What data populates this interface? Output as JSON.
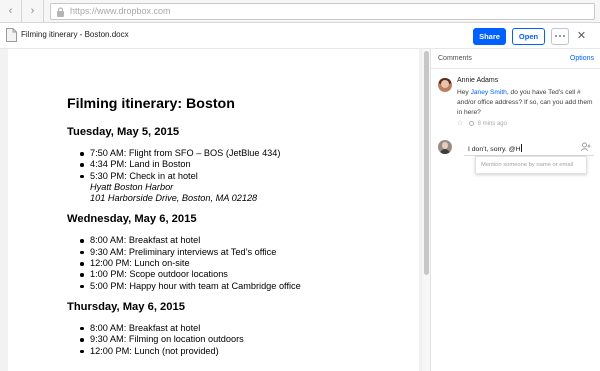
{
  "browser": {
    "url": "https://www.dropbox.com",
    "back_icon": "chevron-left-icon",
    "forward_icon": "chevron-right-icon",
    "lock_icon": "lock-icon"
  },
  "header": {
    "file_name": "Filming itinerary - Boston.docx",
    "share_label": "Share",
    "open_label": "Open",
    "more_icon": "more-icon",
    "close_icon": "close-icon",
    "colors": {
      "accent": "#0061fe"
    }
  },
  "document": {
    "title": "Filming itinerary: Boston",
    "sections": [
      {
        "heading": "Tuesday, May 5, 2015",
        "items": [
          {
            "text": "7:50 AM: Flight from SFO – BOS (JetBlue 434)"
          },
          {
            "text": "4:34 PM: Land in Boston"
          },
          {
            "text": "5:30 PM: Check in at hotel",
            "sub1": "Hyatt Boston Harbor",
            "sub2": "101 Harborside Drive, Boston, MA 02128"
          }
        ]
      },
      {
        "heading": "Wednesday, May 6, 2015",
        "items": [
          {
            "text": "8:00 AM: Breakfast at hotel"
          },
          {
            "text": "9:30 AM: Preliminary interviews at Ted’s office"
          },
          {
            "text": "12:00 PM: Lunch on-site"
          },
          {
            "text": "1:00 PM: Scope outdoor locations"
          },
          {
            "text": "5:00 PM: Happy hour with team at Cambridge office"
          }
        ]
      },
      {
        "heading": "Thursday, May 6, 2015",
        "items": [
          {
            "text": "8:00 AM: Breakfast at hotel"
          },
          {
            "text": "9:30 AM: Filming on location outdoors"
          },
          {
            "text": "12:00 PM: Lunch (not provided)"
          }
        ]
      }
    ]
  },
  "comments": {
    "title": "Comments",
    "options_label": "Options",
    "thread": {
      "author": "Annie Adams",
      "text_before": "Hey ",
      "mention": "Janey Smith",
      "text_after": ", do you have Ted’s cell # and/or office address? If so, can you add them in here?",
      "time": "8 mins ago",
      "star_icon": "star-icon",
      "clock_icon": "clock-icon"
    },
    "reply": {
      "value": "I don’t, sorry. @H",
      "add_person_icon": "add-person-icon",
      "mention_hint": "Mention someone by name or email"
    }
  }
}
